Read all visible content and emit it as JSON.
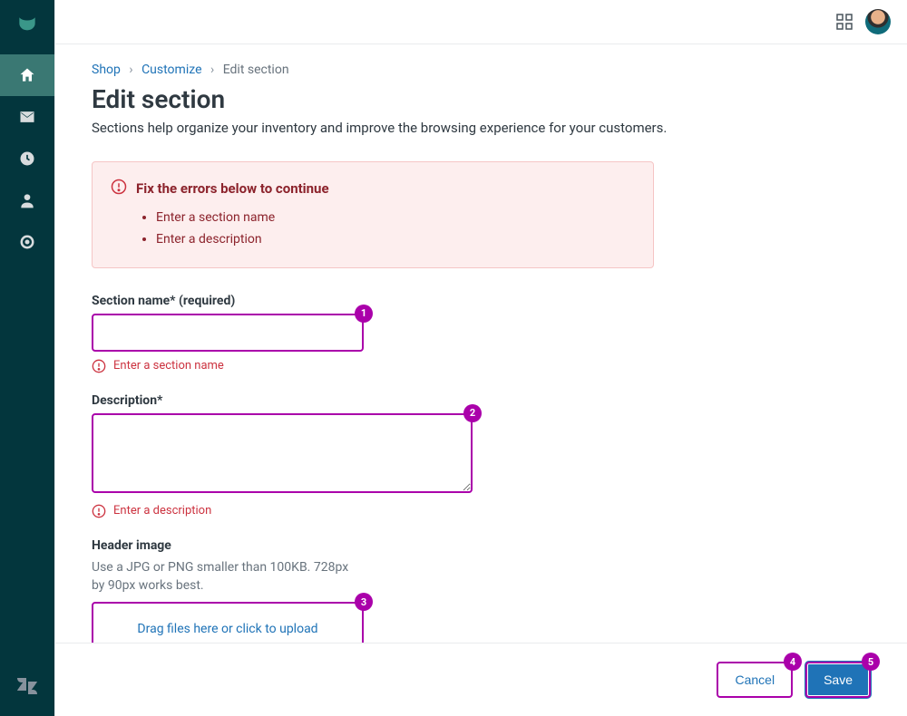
{
  "breadcrumb": {
    "root": "Shop",
    "mid": "Customize",
    "current": "Edit section"
  },
  "page": {
    "title": "Edit section",
    "subtitle": "Sections help organize your inventory and improve the browsing experience for your customers."
  },
  "alert": {
    "title": "Fix the errors below to continue",
    "items": [
      "Enter a section name",
      "Enter a description"
    ]
  },
  "form": {
    "section_name": {
      "label": "Section name* (required)",
      "value": "",
      "error": "Enter a section name"
    },
    "description": {
      "label": "Description*",
      "value": "",
      "error": "Enter a description"
    },
    "header_image": {
      "label": "Header image",
      "hint": "Use a JPG or PNG smaller than 100KB. 728px by 90px works best.",
      "upload_text": "Drag files here or click to upload"
    }
  },
  "footer": {
    "cancel": "Cancel",
    "save": "Save"
  },
  "annotations": {
    "1": "1",
    "2": "2",
    "3": "3",
    "4": "4",
    "5": "5"
  }
}
